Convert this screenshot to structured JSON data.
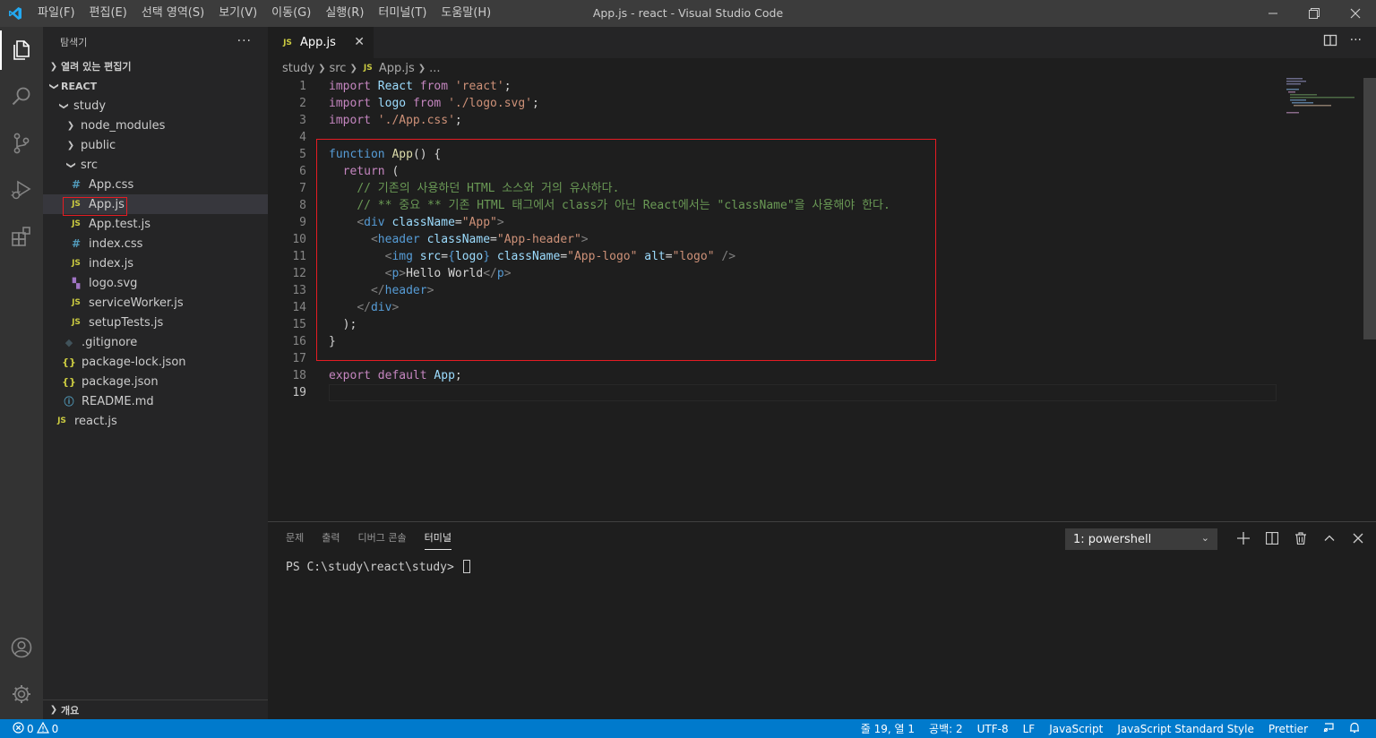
{
  "window": {
    "title": "App.js - react - Visual Studio Code",
    "menus": [
      "파일(F)",
      "편집(E)",
      "선택 영역(S)",
      "보기(V)",
      "이동(G)",
      "실행(R)",
      "터미널(T)",
      "도움말(H)"
    ]
  },
  "sidebar": {
    "title": "탐색기",
    "open_editors": "열려 있는 편집기",
    "workspace": "REACT",
    "outline": "개요",
    "tree": [
      {
        "label": "study",
        "type": "folder-open"
      },
      {
        "label": "node_modules",
        "type": "folder"
      },
      {
        "label": "public",
        "type": "folder"
      },
      {
        "label": "src",
        "type": "folder-open"
      },
      {
        "label": "App.css",
        "type": "css"
      },
      {
        "label": "App.js",
        "type": "js"
      },
      {
        "label": "App.test.js",
        "type": "js"
      },
      {
        "label": "index.css",
        "type": "css"
      },
      {
        "label": "index.js",
        "type": "js"
      },
      {
        "label": "logo.svg",
        "type": "svg"
      },
      {
        "label": "serviceWorker.js",
        "type": "js"
      },
      {
        "label": "setupTests.js",
        "type": "js"
      },
      {
        "label": ".gitignore",
        "type": "git"
      },
      {
        "label": "package-lock.json",
        "type": "json"
      },
      {
        "label": "package.json",
        "type": "json"
      },
      {
        "label": "README.md",
        "type": "info"
      },
      {
        "label": "react.js",
        "type": "js"
      }
    ]
  },
  "editor": {
    "tab_label": "App.js",
    "breadcrumb": [
      "study",
      "src",
      "App.js",
      "..."
    ],
    "line_numbers": [
      "1",
      "2",
      "3",
      "4",
      "5",
      "6",
      "7",
      "8",
      "9",
      "10",
      "11",
      "12",
      "13",
      "14",
      "15",
      "16",
      "17",
      "18",
      "19"
    ],
    "comment_line_7": "// 기존의 사용하던 HTML 소스와 거의 유사하다.",
    "comment_line_8": "// ** 중요 ** 기존 HTML 태그에서 class가 아닌 React에서는 \"className\"을 사용해야 한다.",
    "greeting": "Hello World"
  },
  "panel": {
    "tabs": [
      "문제",
      "출력",
      "디버그 콘솔",
      "터미널"
    ],
    "terminal_select": "1: powershell",
    "prompt": "PS C:\\study\\react\\study> "
  },
  "status": {
    "errors": "0",
    "warnings": "0",
    "position": "줄 19, 열 1",
    "spaces": "공백: 2",
    "encoding": "UTF-8",
    "eol": "LF",
    "language": "JavaScript",
    "linter": "JavaScript Standard Style",
    "formatter": "Prettier"
  }
}
